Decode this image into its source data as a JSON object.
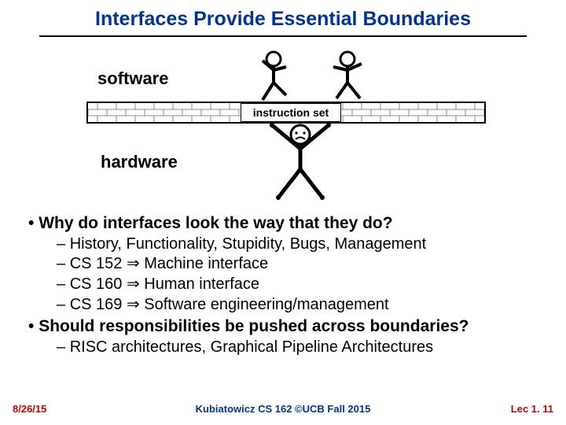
{
  "title": "Interfaces Provide Essential Boundaries",
  "diagram": {
    "software_label": "software",
    "hardware_label": "hardware",
    "instruction_set_label": "instruction set"
  },
  "bullets": [
    {
      "text": "Why do interfaces look the way that they do?",
      "sub": [
        "History, Functionality, Stupidity, Bugs, Management",
        "CS 152 ⇒ Machine interface",
        "CS 160 ⇒ Human interface",
        "CS 169 ⇒ Software engineering/management"
      ]
    },
    {
      "text": "Should responsibilities be pushed across boundaries?",
      "sub": [
        "RISC architectures, Graphical Pipeline Architectures"
      ]
    }
  ],
  "footer": {
    "left": "8/26/15",
    "center": "Kubiatowicz CS 162 ©UCB Fall 2015",
    "right": "Lec 1. 11"
  }
}
